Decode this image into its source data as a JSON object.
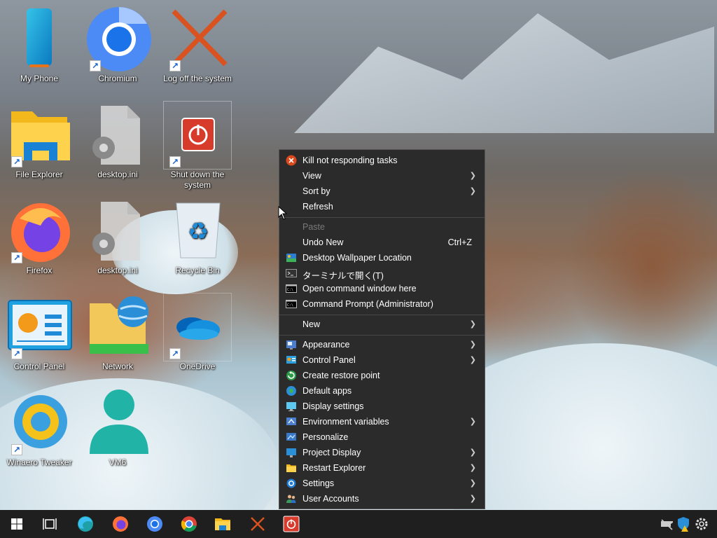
{
  "desktop": {
    "icons": [
      {
        "label": "My Phone"
      },
      {
        "label": "Chromium"
      },
      {
        "label": "Log off the system"
      },
      {
        "label": "File Explorer"
      },
      {
        "label": "desktop.ini"
      },
      {
        "label": "Shut down the system"
      },
      {
        "label": "Firefox"
      },
      {
        "label": "desktop.ini"
      },
      {
        "label": "Recycle Bin"
      },
      {
        "label": "Control Panel"
      },
      {
        "label": "Network"
      },
      {
        "label": "OneDrive"
      },
      {
        "label": "Winaero Tweaker"
      },
      {
        "label": "VM6"
      }
    ]
  },
  "context_menu": {
    "items": [
      {
        "label": "Kill not responding tasks",
        "icon": "kill-icon"
      },
      {
        "label": "View",
        "submenu": true
      },
      {
        "label": "Sort by",
        "submenu": true
      },
      {
        "label": "Refresh"
      },
      {
        "label": "Paste",
        "disabled": true
      },
      {
        "label": "Undo New",
        "shortcut": "Ctrl+Z"
      },
      {
        "label": "Desktop Wallpaper Location",
        "icon": "wallpaper-icon"
      },
      {
        "label": "ターミナルで開く(T)",
        "icon": "terminal-icon"
      },
      {
        "label": "Open command window here",
        "icon": "cmd-icon"
      },
      {
        "label": "Command Prompt (Administrator)",
        "icon": "cmd-admin-icon"
      },
      {
        "label": "New",
        "submenu": true
      },
      {
        "label": "Appearance",
        "submenu": true,
        "icon": "appearance-icon"
      },
      {
        "label": "Control Panel",
        "submenu": true,
        "icon": "control-panel-icon"
      },
      {
        "label": "Create restore point",
        "icon": "restore-point-icon"
      },
      {
        "label": "Default apps",
        "icon": "default-apps-icon"
      },
      {
        "label": "Display settings",
        "icon": "display-icon"
      },
      {
        "label": "Environment variables",
        "submenu": true,
        "icon": "env-vars-icon"
      },
      {
        "label": "Personalize",
        "icon": "personalize-icon"
      },
      {
        "label": "Project Display",
        "submenu": true,
        "icon": "project-display-icon"
      },
      {
        "label": "Restart Explorer",
        "submenu": true,
        "icon": "folder-icon"
      },
      {
        "label": "Settings",
        "submenu": true,
        "icon": "settings-gear-icon"
      },
      {
        "label": "User Accounts",
        "submenu": true,
        "icon": "user-accounts-icon"
      }
    ]
  },
  "taskbar": {
    "items": [
      "start-icon",
      "task-view-icon",
      "edge-icon",
      "firefox-icon",
      "chromium-icon",
      "chrome-icon",
      "file-explorer-icon",
      "logoff-icon",
      "shutdown-icon"
    ],
    "tray": [
      "network-disconnected-icon",
      "security-warning-icon",
      "settings-gear-icon"
    ]
  },
  "colors": {
    "menu_bg": "#2b2b2b",
    "taskbar_bg": "#1f1f1f",
    "accent": "#0078d4"
  }
}
